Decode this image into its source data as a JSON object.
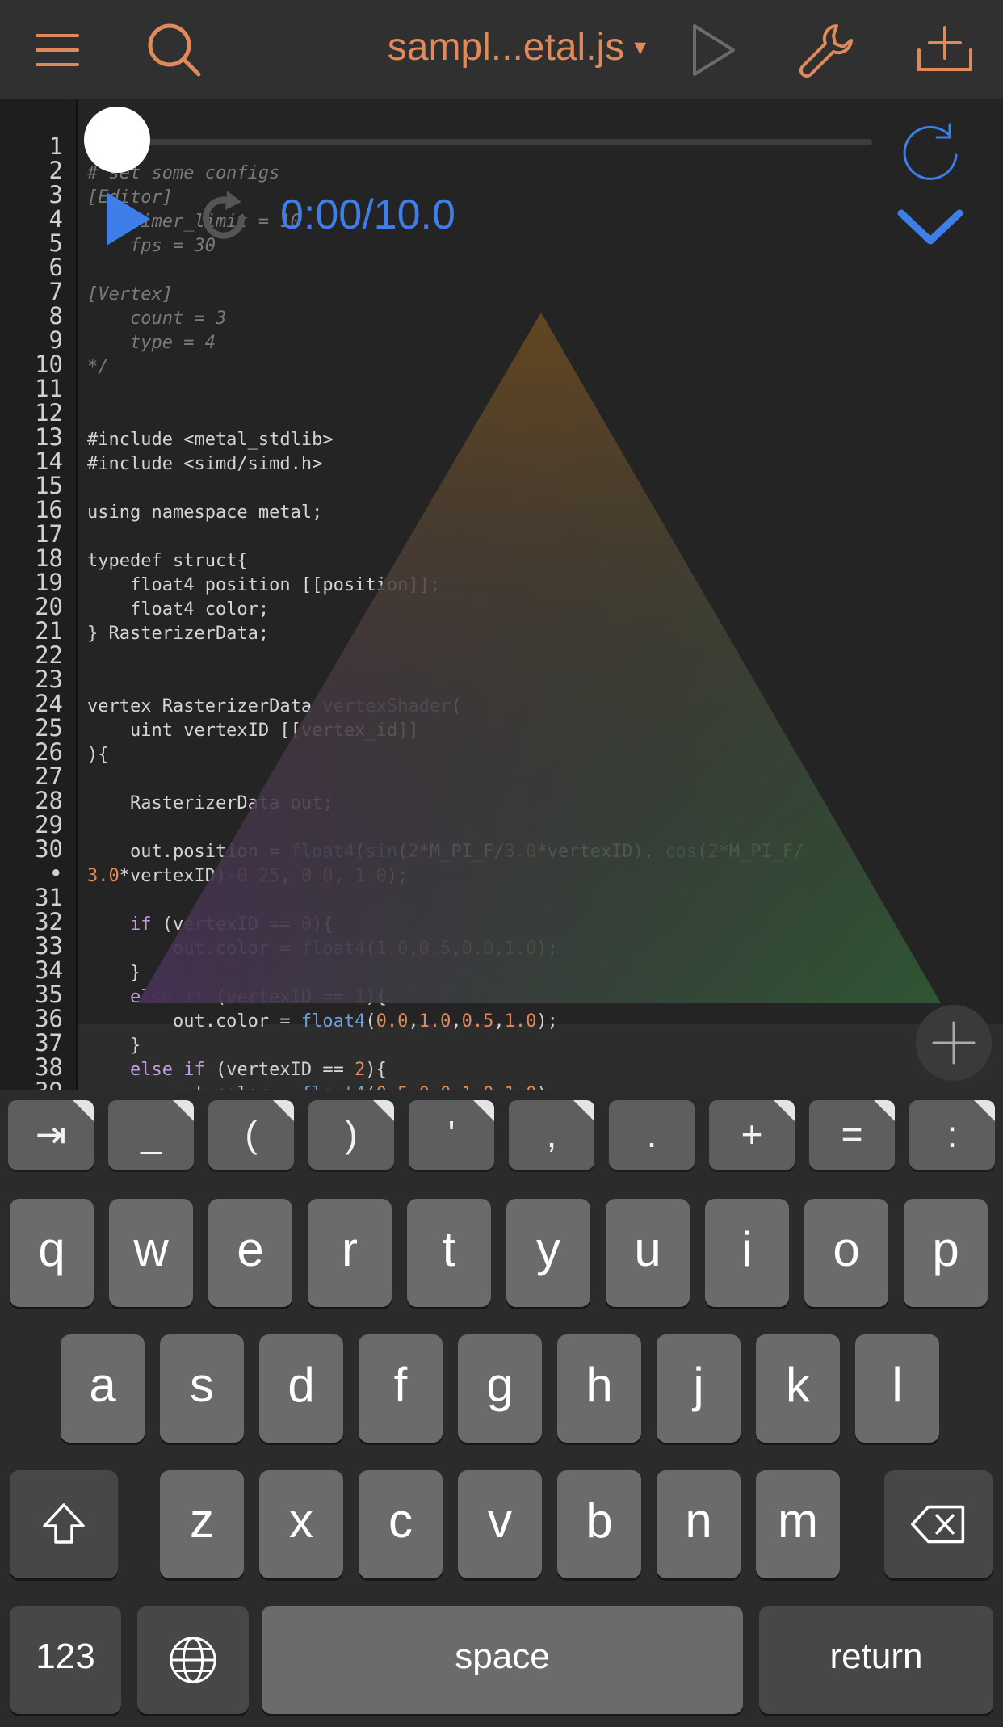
{
  "toolbar": {
    "menu_icon": "hamburger-menu-icon",
    "search_icon": "search-icon",
    "file_title": "sampl...etal.js",
    "title_caret": "▾",
    "run_icon": "play-icon",
    "settings_icon": "wrench-icon",
    "export_icon": "add-to-tray-icon"
  },
  "editor": {
    "line_numbers": "1\n2\n3\n4\n5\n6\n7\n8\n9\n10\n11\n12\n13\n14\n15\n16\n17\n18\n19\n20\n21\n22\n23\n24\n25\n26\n27\n28\n29\n30\n•\n31\n32\n33\n34\n35\n36\n37\n38\n39",
    "lines": {
      "l2": "# set some configs",
      "l3": "[Editor]",
      "l4": "    timer_limit = 10",
      "l5": "    fps = 30",
      "l7": "[Vertex]",
      "l8": "    count = 3",
      "l9": "    type = 4",
      "l10": "*/",
      "l13": "#include <metal_stdlib>",
      "l14": "#include <simd/simd.h>",
      "l16": "using namespace metal;",
      "l18": "typedef struct{",
      "l19": "    float4 position [[position]];",
      "l20": "    float4 color;",
      "l21": "} RasterizerData;",
      "l24a": "vertex RasterizerData ",
      "l24b": "vertexShader",
      "l24c": "(",
      "l25": "    uint vertexID [[vertex_id]]",
      "l26": "){",
      "l28": "    RasterizerData out;",
      "l30_prefix": "    out.position = ",
      "l30_cont_a": "3.0",
      "l30_cont_b": "*vertexID)-",
      "l30_cont_c": "0.25",
      "l30_cont_d": ", ",
      "l30_cont_e": "0.0",
      "l30_cont_f": ", ",
      "l30_cont_g": "1.0",
      "l30_cont_h": ");",
      "if_kw": "if",
      "else_kw": "else",
      "float4": "float4",
      "sin": "sin",
      "cos": "cos"
    },
    "player": {
      "time": "0:00/10.0",
      "play_icon": "play-icon",
      "reload_icon": "reload-icon",
      "refresh_icon": "refresh-icon",
      "collapse_icon": "chevron-down-icon",
      "add_icon": "plus-icon"
    }
  },
  "accessory_keys": [
    "⇥",
    "_",
    "(",
    ")",
    "'",
    ",",
    ".",
    "+",
    "=",
    ":"
  ],
  "keyboard": {
    "row1": [
      "q",
      "w",
      "e",
      "r",
      "t",
      "y",
      "u",
      "i",
      "o",
      "p"
    ],
    "row2": [
      "a",
      "s",
      "d",
      "f",
      "g",
      "h",
      "j",
      "k",
      "l"
    ],
    "row3": [
      "z",
      "x",
      "c",
      "v",
      "b",
      "n",
      "m"
    ],
    "shift_icon": "shift-icon",
    "delete_icon": "delete-backspace-icon",
    "numbers_label": "123",
    "globe_icon": "globe-icon",
    "space_label": "space",
    "return_label": "return"
  },
  "colors": {
    "accent_orange": "#e0895a",
    "player_blue": "#3d7ee8",
    "background": "#232323"
  }
}
